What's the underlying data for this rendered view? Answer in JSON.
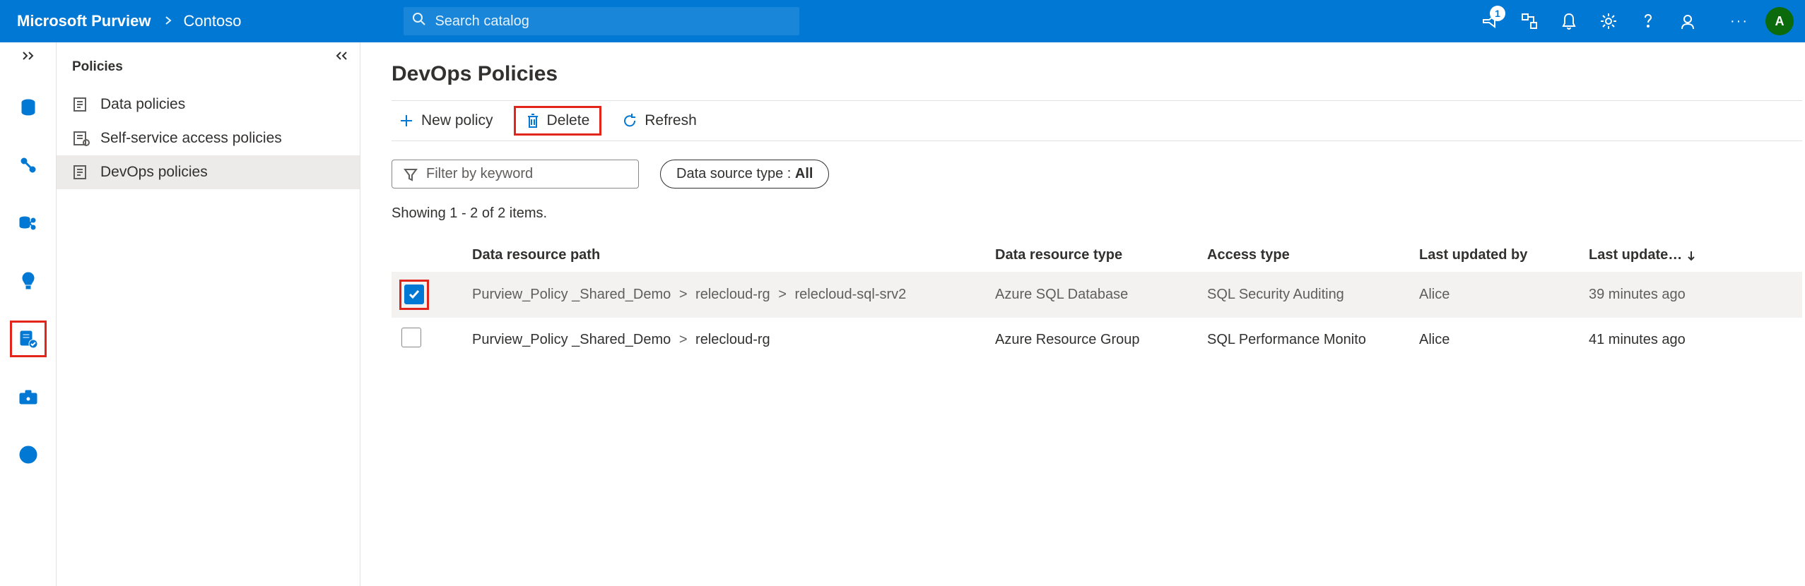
{
  "header": {
    "brand": "Microsoft Purview",
    "breadcrumb": "Contoso",
    "search_placeholder": "Search catalog",
    "notif_badge": "1",
    "avatar_initial": "A",
    "overflow": "···"
  },
  "sidebar": {
    "title": "Policies",
    "items": [
      {
        "label": "Data policies"
      },
      {
        "label": "Self-service access policies"
      },
      {
        "label": "DevOps policies"
      }
    ]
  },
  "page": {
    "title": "DevOps Policies",
    "toolbar": {
      "new_label": "New policy",
      "delete_label": "Delete",
      "refresh_label": "Refresh"
    },
    "filters": {
      "keyword_placeholder": "Filter by keyword",
      "source_type_label": "Data source type : ",
      "source_type_value": "All"
    },
    "count_text": "Showing 1 - 2 of 2 items.",
    "columns": {
      "path": "Data resource path",
      "type": "Data resource type",
      "access": "Access type",
      "updated_by": "Last updated by",
      "updated_at": "Last update…"
    },
    "rows": [
      {
        "checked": true,
        "path_parts": [
          "Purview_Policy _Shared_Demo",
          "relecloud-rg",
          "relecloud-sql-srv2"
        ],
        "type": "Azure SQL Database",
        "access": "SQL Security Auditing",
        "updated_by": "Alice",
        "updated_at": "39 minutes ago"
      },
      {
        "checked": false,
        "path_parts": [
          "Purview_Policy _Shared_Demo",
          "relecloud-rg"
        ],
        "type": "Azure Resource Group",
        "access": "SQL Performance Monito",
        "updated_by": "Alice",
        "updated_at": "41 minutes ago"
      }
    ]
  }
}
